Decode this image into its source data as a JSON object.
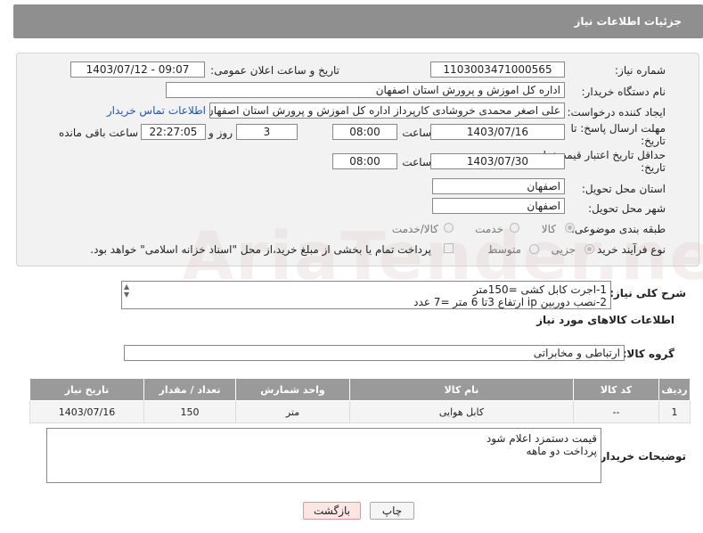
{
  "header": {
    "title": "جزئیات اطلاعات نیاز"
  },
  "form": {
    "need_number_label": "شماره نیاز:",
    "need_number": "1103003471000565",
    "announce_label": "تاریخ و ساعت اعلان عمومی:",
    "announce_value": "1403/07/12 - 09:07",
    "buyer_label": "نام دستگاه خریدار:",
    "buyer_value": "اداره کل اموزش و پرورش استان اصفهان",
    "creator_label": "ایجاد کننده درخواست:",
    "creator_value": "علی اصغر محمدی خروشادی کارپرداز اداره کل اموزش و پرورش استان اصفهان",
    "contact_link": "اطلاعات تماس خریدار",
    "reply_deadline_label": "مهلت ارسال پاسخ: تا",
    "reply_deadline_label2": "تاریخ:",
    "reply_date": "1403/07/16",
    "time_label": "ساعت",
    "reply_time": "08:00",
    "days_value": "3",
    "days_label": "روز و",
    "remaining_time": "22:27:05",
    "remaining_label": "ساعت باقی مانده",
    "price_deadline_label": "حداقل تاریخ اعتبار قیمت: تا",
    "price_deadline_label2": "تاریخ:",
    "price_date": "1403/07/30",
    "price_time": "08:00",
    "province_label": "استان محل تحویل:",
    "province_value": "اصفهان",
    "city_label": "شهر محل تحویل:",
    "city_value": "اصفهان",
    "category_label": "طبقه بندی موضوعی:",
    "category_options": [
      "کالا",
      "خدمت",
      "کالا/خدمت"
    ],
    "process_label": "نوع فرآیند خرید :",
    "process_options": [
      "جزیی",
      "متوسط"
    ],
    "process_note": "پرداخت تمام یا بخشی از مبلغ خرید،از محل \"اسناد خزانه اسلامی\" خواهد بود."
  },
  "description": {
    "label": "شرح کلی نیاز:",
    "line1": "1-اجرت کابل کشی =150متر",
    "line2": "2-نصب دوربین ip ارتفاع 3تا 6 متر =7 عدد"
  },
  "goods_section": {
    "title": "اطلاعات کالاهای مورد نیاز",
    "group_label": "گروه کالا:",
    "group_value": "ارتباطی و مخابراتی"
  },
  "table": {
    "headers": [
      "ردیف",
      "کد کالا",
      "نام کالا",
      "واحد شمارش",
      "تعداد / مقدار",
      "تاریخ نیاز"
    ],
    "rows": [
      [
        "1",
        "--",
        "کابل هوایی",
        "متر",
        "150",
        "1403/07/16"
      ]
    ]
  },
  "buyer_notes": {
    "label": "توضیحات خریدار:",
    "line1": "قیمت دستمزد اعلام شود",
    "line2": "پرداخت دو ماهه"
  },
  "buttons": {
    "print": "چاپ",
    "back": "بازگشت"
  },
  "watermark": "AriaTender.neT",
  "colors": {
    "header_bg": "#8f8f8f",
    "link": "#1a56c2",
    "back_button_bg": "#fbe5e5"
  }
}
